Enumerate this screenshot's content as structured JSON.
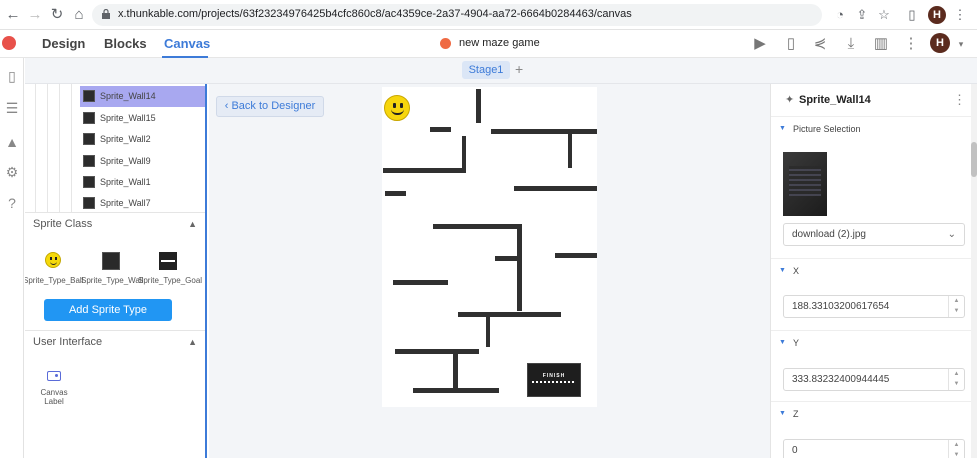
{
  "browser": {
    "url": "x.thunkable.com/projects/63f23234976425b4cfc860c8/ac4359ce-2a37-4904-aa72-6664b0284463/canvas",
    "profile_initial": "H"
  },
  "header": {
    "tabs": [
      {
        "label": "Design"
      },
      {
        "label": "Blocks"
      },
      {
        "label": "Canvas"
      }
    ],
    "active_tab": "Canvas",
    "project_name": "new maze game",
    "profile_initial": "H"
  },
  "stage_bar": {
    "stage_label": "Stage1",
    "add_label": "+"
  },
  "left_panel": {
    "sprites": [
      {
        "label": "Sprite_Wall14",
        "selected": true
      },
      {
        "label": "Sprite_Wall15",
        "selected": false
      },
      {
        "label": "Sprite_Wall2",
        "selected": false
      },
      {
        "label": "Sprite_Wall9",
        "selected": false
      },
      {
        "label": "Sprite_Wall1",
        "selected": false
      },
      {
        "label": "Sprite_Wall7",
        "selected": false
      }
    ],
    "sprite_class_title": "Sprite Class",
    "sprite_classes": [
      {
        "label": "Sprite_Type_Ball",
        "icon": "smiley-icon"
      },
      {
        "label": "Sprite_Type_Wall",
        "icon": "wall-icon"
      },
      {
        "label": "Sprite_Type_Goal",
        "icon": "goal-icon"
      }
    ],
    "add_sprite_type_label": "Add Sprite Type",
    "user_interface_title": "User Interface",
    "canvas_label_item": {
      "line1": "Canvas",
      "line2": "Label"
    }
  },
  "canvas": {
    "back_label": "‹  Back to Designer",
    "finish_text": "FINISH"
  },
  "right_panel": {
    "title": "Sprite_Wall14",
    "picture_section": "Picture Selection",
    "picture_value": "download (2).jpg",
    "x_section": "X",
    "x_value": "188.33103200617654",
    "y_section": "Y",
    "y_value": "333.83232400944445",
    "z_section": "Z",
    "z_value": "0"
  },
  "colors": {
    "accent": "#3d7bd8",
    "selected_row": "#a8a8f0",
    "add_button": "#2196f3"
  }
}
